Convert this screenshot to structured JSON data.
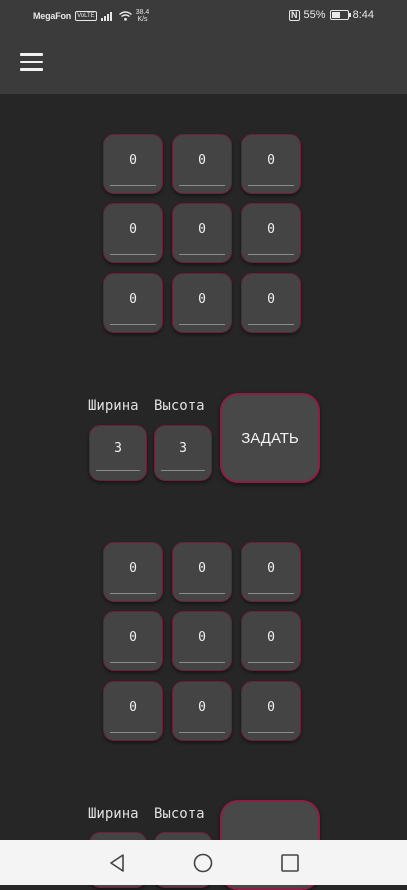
{
  "status_bar": {
    "carrier": "MegaFon",
    "network_badge": "VoLTE",
    "net_speed_value": "38.4",
    "net_speed_unit": "K/s",
    "nfc": "N",
    "battery_percent": "55%",
    "battery_level": 0.55,
    "time": "8:44"
  },
  "app_bar": {
    "menu_icon": "hamburger-menu-icon"
  },
  "matrix_1": {
    "cells": [
      [
        "0",
        "0",
        "0"
      ],
      [
        "0",
        "0",
        "0"
      ],
      [
        "0",
        "0",
        "0"
      ]
    ],
    "width_label": "Ширина",
    "height_label": "Высота",
    "width_value": "3",
    "height_value": "3",
    "set_button": "ЗАДАТЬ"
  },
  "matrix_2": {
    "cells": [
      [
        "0",
        "0",
        "0"
      ],
      [
        "0",
        "0",
        "0"
      ],
      [
        "0",
        "0",
        "0"
      ]
    ],
    "width_label": "Ширина",
    "height_label": "Высота"
  },
  "nav_bar": {
    "back_icon": "back-triangle-icon",
    "home_icon": "home-circle-icon",
    "recents_icon": "recents-square-icon"
  },
  "colors": {
    "background": "#262626",
    "app_bar": "#3b3b3b",
    "cell_fill": "#444444",
    "cell_border": "#6e1f3b",
    "nav_bar": "#f4f4f4"
  }
}
